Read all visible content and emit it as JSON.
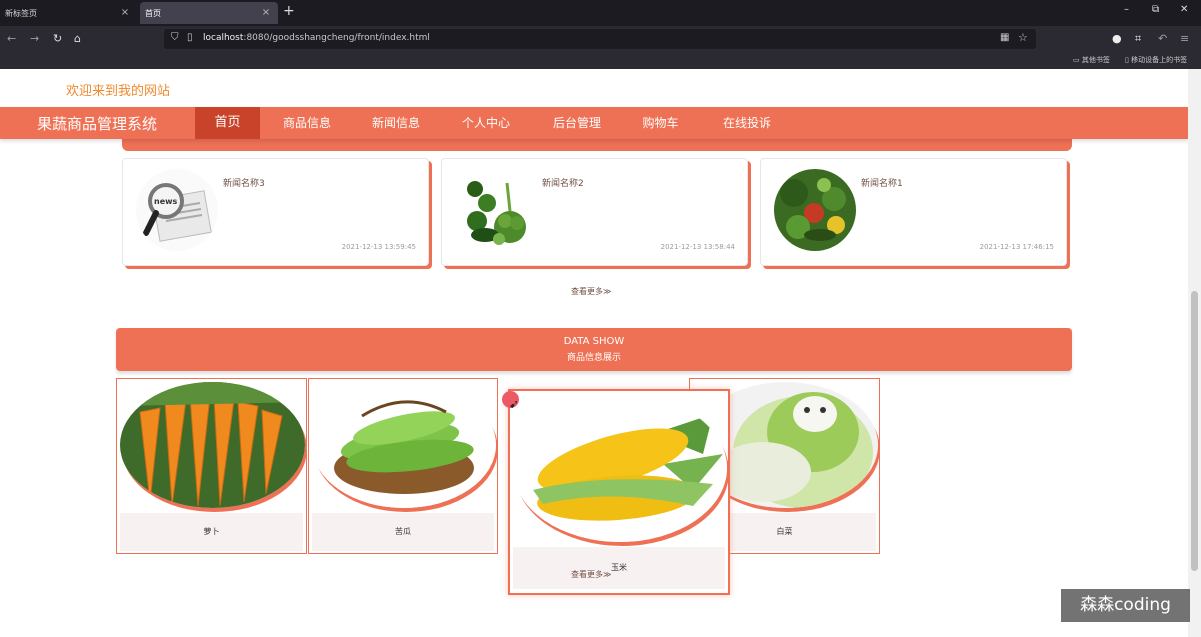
{
  "browser": {
    "tabs": [
      {
        "label": "新标签页",
        "active": false
      },
      {
        "label": "首页",
        "active": true
      }
    ],
    "new_tab_symbol": "+",
    "close_symbol": "×",
    "window_controls": {
      "minimize": "–",
      "maximize": "⧉",
      "close": "✕"
    },
    "url": {
      "host": "localhost",
      "rest": ":8080/goodsshangcheng/front/index.html"
    },
    "bookmarks": [
      {
        "label": "其他书签"
      },
      {
        "label": "移动设备上的书签"
      }
    ]
  },
  "site": {
    "welcome": "欢迎来到我的网站",
    "brand": "果蔬商品管理系统",
    "menu": [
      {
        "label": "首页",
        "active": true
      },
      {
        "label": "商品信息"
      },
      {
        "label": "新闻信息"
      },
      {
        "label": "个人中心"
      },
      {
        "label": "后台管理"
      },
      {
        "label": "购物车"
      },
      {
        "label": "在线投诉"
      }
    ]
  },
  "news": {
    "items": [
      {
        "title": "新闻名称3",
        "date": "2021-12-13 13:59:45",
        "image": "news-magnifier"
      },
      {
        "title": "新闻名称2",
        "date": "2021-12-13 13:58:44",
        "image": "vegetables-pile"
      },
      {
        "title": "新闻名称1",
        "date": "2021-12-13 17:46:15",
        "image": "vegetables-basket"
      }
    ],
    "more": "查看更多≫"
  },
  "products": {
    "banner_en": "DATA SHOW",
    "banner_cn": "商品信息展示",
    "items": [
      {
        "name": "萝卜",
        "image": "carrots"
      },
      {
        "name": "苦瓜",
        "image": "bitter-gourd"
      },
      {
        "name": "玉米",
        "image": "corn"
      },
      {
        "name": "白菜",
        "image": "cabbage"
      }
    ],
    "more": "查看更多≫"
  },
  "watermark": "森森coding",
  "colors": {
    "accent": "#ef7155",
    "accent_dark": "#c9432b",
    "welcome": "#ef8a2f"
  }
}
